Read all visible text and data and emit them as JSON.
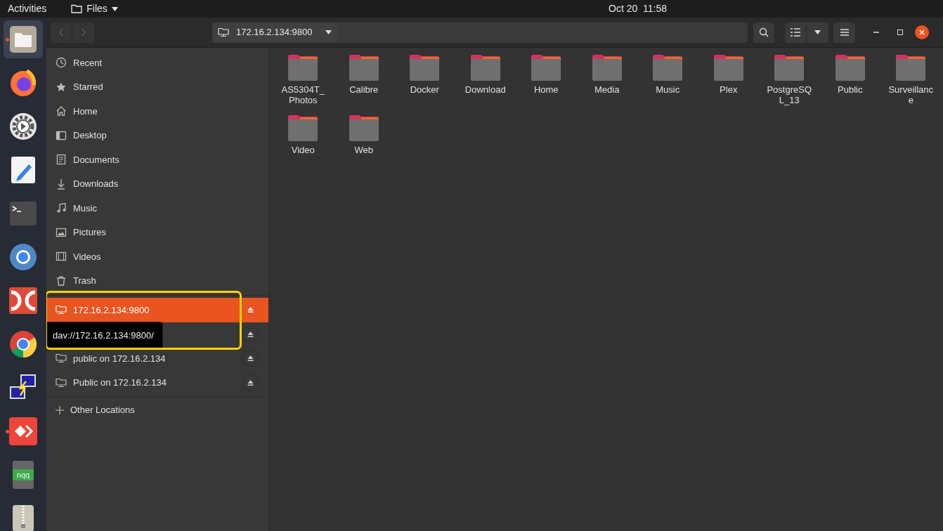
{
  "top_bar": {
    "activities": "Activities",
    "app_menu": "Files",
    "clock": "Oct 20  11:58"
  },
  "dock": [
    {
      "kind": "files",
      "running": true,
      "selected": true
    },
    {
      "kind": "firefox",
      "running": false,
      "selected": false
    },
    {
      "kind": "settings",
      "running": false,
      "selected": false
    },
    {
      "kind": "editor",
      "running": false,
      "selected": false
    },
    {
      "kind": "terminal",
      "running": false,
      "selected": false
    },
    {
      "kind": "chromium",
      "running": false,
      "selected": false
    },
    {
      "kind": "doublecmd",
      "running": false,
      "selected": false
    },
    {
      "kind": "chrome",
      "running": false,
      "selected": false
    },
    {
      "kind": "network",
      "running": false,
      "selected": false
    },
    {
      "kind": "anydesk",
      "running": true,
      "selected": false
    },
    {
      "kind": "notebook",
      "running": false,
      "selected": false,
      "text": "nqq"
    },
    {
      "kind": "archive",
      "running": false,
      "selected": false
    }
  ],
  "header": {
    "path": "172.16.2.134:9800"
  },
  "sidebar": {
    "places": [
      {
        "kind": "recent",
        "label": "Recent"
      },
      {
        "kind": "starred",
        "label": "Starred"
      },
      {
        "kind": "home",
        "label": "Home"
      },
      {
        "kind": "desktop",
        "label": "Desktop"
      },
      {
        "kind": "documents",
        "label": "Documents"
      },
      {
        "kind": "downloads",
        "label": "Downloads"
      },
      {
        "kind": "music",
        "label": "Music"
      },
      {
        "kind": "pictures",
        "label": "Pictures"
      },
      {
        "kind": "videos",
        "label": "Videos"
      },
      {
        "kind": "trash",
        "label": "Trash"
      }
    ],
    "mounts": [
      {
        "label": "172.16.2.134:9800",
        "selected": true
      },
      {
        "selected": false
      },
      {
        "label": "public on 172.16.2.134",
        "selected": false
      },
      {
        "label": "Public on 172.16.2.134",
        "selected": false
      }
    ],
    "other": "Other Locations"
  },
  "tooltip": "dav://172.16.2.134:9800/",
  "folders": [
    {
      "label_lines": [
        "AS5304T_",
        "Photos"
      ]
    },
    {
      "label_lines": [
        "Calibre"
      ]
    },
    {
      "label_lines": [
        "Docker"
      ]
    },
    {
      "label_lines": [
        "Download"
      ]
    },
    {
      "label_lines": [
        "Home"
      ]
    },
    {
      "label_lines": [
        "Media"
      ]
    },
    {
      "label_lines": [
        "Music"
      ]
    },
    {
      "label_lines": [
        "Plex"
      ]
    },
    {
      "label_lines": [
        "PostgreSQ",
        "L_13"
      ]
    },
    {
      "label_lines": [
        "Public"
      ]
    },
    {
      "label_lines": [
        "Surveillanc",
        "e"
      ]
    },
    {
      "label_lines": [
        "Video"
      ]
    },
    {
      "label_lines": [
        "Web"
      ]
    }
  ]
}
